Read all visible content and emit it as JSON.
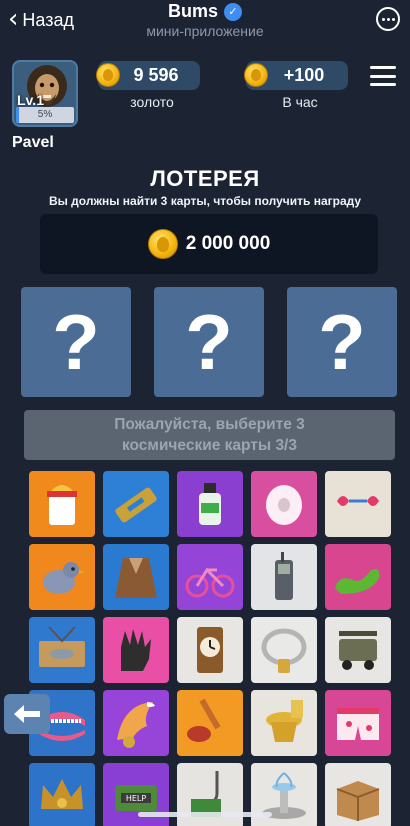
{
  "topbar": {
    "back_label": "Назад",
    "app_name": "Bums",
    "app_subtitle": "мини-приложение"
  },
  "profile": {
    "level": "Lv.1",
    "level_progress": "5%",
    "level_progress_value": 5,
    "username": "Pavel"
  },
  "stats": {
    "gold_value": "9 596",
    "gold_caption": "золото",
    "per_hour_value": "+100",
    "per_hour_caption": "В час"
  },
  "lottery": {
    "title": "ЛОТЕРЕЯ",
    "subtitle": "Вы должны найти 3 карты, чтобы получить награду",
    "prize": "2 000 000",
    "mystery_cards": [
      "?",
      "?",
      "?"
    ],
    "confirm_line1": "Пожалуйста, выберите 3",
    "confirm_line2": "космические карты 3/3"
  },
  "cards": [
    {
      "name": "noodle-cup-icon",
      "bg": "#f08a1c"
    },
    {
      "name": "razor-blade-icon",
      "bg": "#2e7fd6"
    },
    {
      "name": "glue-bottle-icon",
      "bg": "#8a3fd1"
    },
    {
      "name": "toilet-paper-icon",
      "bg": "#d94fa0"
    },
    {
      "name": "heart-glasses-icon",
      "bg": "#e8e1d6"
    },
    {
      "name": "pigeon-icon",
      "bg": "#f0881d"
    },
    {
      "name": "fur-coat-icon",
      "bg": "#2a7ad1"
    },
    {
      "name": "bicycle-icon",
      "bg": "#9444d6"
    },
    {
      "name": "cell-phone-icon",
      "bg": "#e3e4e6"
    },
    {
      "name": "shoe-icon",
      "bg": "#d7468e"
    },
    {
      "name": "fish-sign-icon",
      "bg": "#2f79cf"
    },
    {
      "name": "glove-icon",
      "bg": "#ea4fa6"
    },
    {
      "name": "clock-icon",
      "bg": "#e8e6e3"
    },
    {
      "name": "chain-icon",
      "bg": "#e9e9e8"
    },
    {
      "name": "golf-cart-icon",
      "bg": "#e8e6e2"
    },
    {
      "name": "dentures-icon",
      "bg": "#2f74c8"
    },
    {
      "name": "fox-tail-icon",
      "bg": "#9645d8"
    },
    {
      "name": "toilet-brush-icon",
      "bg": "#f29a24"
    },
    {
      "name": "golden-toilet-icon",
      "bg": "#e8e5de"
    },
    {
      "name": "boxers-icon",
      "bg": "#d74795"
    },
    {
      "name": "crown-icon",
      "bg": "#2d73c9"
    },
    {
      "name": "money-help-icon",
      "bg": "#8a3fd4"
    },
    {
      "name": "money-hook-icon",
      "bg": "#e6e4e1"
    },
    {
      "name": "fountain-icon",
      "bg": "#e8e6e2"
    },
    {
      "name": "cardboard-box-icon",
      "bg": "#e8e6e2"
    }
  ],
  "colors": {
    "background": "#1c2433",
    "accent": "#3d8ef0",
    "mystery_card": "#4a6c95",
    "stat_pill": "#2f4a66"
  }
}
